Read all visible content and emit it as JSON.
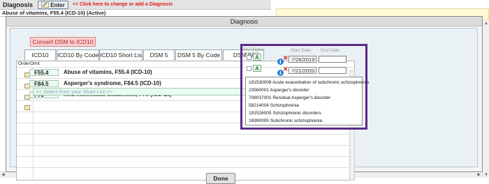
{
  "background": {
    "title": "Diagnosis",
    "enter_label": "Enter",
    "hint": "<< Click here to change or add a Diagnosis",
    "listing_text": "Abuse of vitamins, F55.4 (ICD-10) (Active)"
  },
  "modal": {
    "title": "Diagnosis",
    "convert_label": "Convert DSM to ICD10",
    "tabs": [
      "ICD10",
      "ICD10 By Code",
      "ICD10 Short List",
      "DSM 5",
      "DSM 5 By Code",
      "DSM IV"
    ],
    "active_tab": "ICD10 Short List",
    "columns": {
      "order": "Order",
      "omit": "Omit"
    },
    "rows": [
      {
        "code": "F55.4",
        "description": "Abuse of vitamins, F55.4 (ICD-10)"
      },
      {
        "code": "F84.5",
        "description": "Asperger's syndrome, F84.5 (ICD-10)"
      },
      {
        "code": "F70",
        "description": "Mild intellectual disabilities, F70 (ICD-10)"
      }
    ],
    "select_placeholder": "<< Select from your Short List >>",
    "done_label": "Done"
  },
  "status_panel": {
    "ro_label": "R/O",
    "status_label": "Status",
    "mi_label": "MI",
    "omf_label": "OMF",
    "start_label": "Start Date",
    "end_label": "End Date",
    "entries": [
      {
        "status": "A",
        "start_date": "7/26/2019",
        "end_date": ""
      },
      {
        "status": "A",
        "start_date": "7/21/2020",
        "end_date": ""
      }
    ],
    "options": [
      "191530008 Acute exacerbation of subchronic schizophrenia",
      "23560001 Asperger's disorder",
      "708037001 Residual Asperger's disorder",
      "58214004 Schizophrenia",
      "191526005 Schizophrenic disorders",
      "16990005 Subchronic schizophrenia"
    ]
  },
  "colors": {
    "highlight": "#5c2a86",
    "convert_bg": "#f9d0cf",
    "convert_text": "#b22222",
    "row_code_bg": "#e8fcef",
    "hint_text": "#e01b1b"
  }
}
